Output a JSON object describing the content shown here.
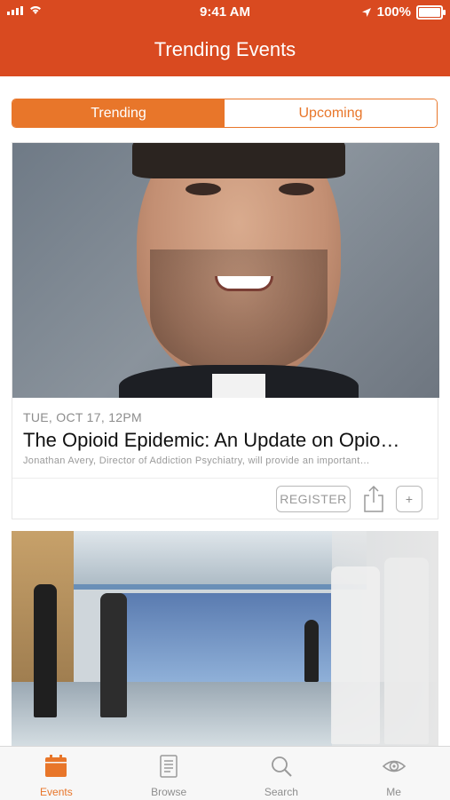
{
  "status_bar": {
    "time": "9:41 AM",
    "battery": "100%"
  },
  "header": {
    "title": "Trending Events"
  },
  "segments": [
    {
      "label": "Trending",
      "active": true
    },
    {
      "label": "Upcoming",
      "active": false
    }
  ],
  "events": [
    {
      "date": "TUE, OCT 17, 12PM",
      "title": "The Opioid Epidemic: An Update on Opio…",
      "description": "Jonathan Avery, Director of Addiction Psychiatry, will provide an important…",
      "register_label": "REGISTER",
      "add_label": "+"
    }
  ],
  "tabbar": [
    {
      "label": "Events",
      "icon": "calendar-icon",
      "active": true
    },
    {
      "label": "Browse",
      "icon": "document-icon",
      "active": false
    },
    {
      "label": "Search",
      "icon": "search-icon",
      "active": false
    },
    {
      "label": "Me",
      "icon": "eye-icon",
      "active": false
    }
  ],
  "colors": {
    "header": "#D94A20",
    "accent": "#E8762A"
  }
}
